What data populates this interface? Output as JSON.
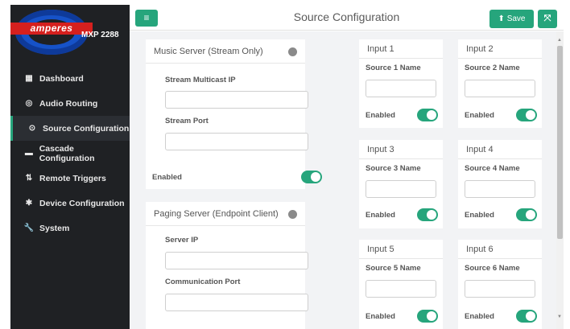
{
  "sidebar": {
    "logo_text": "amperes",
    "model": "MXP 2288",
    "items": [
      {
        "label": "Dashboard",
        "icon": "dashboard-icon",
        "glyph": "▦"
      },
      {
        "label": "Audio Routing",
        "icon": "audio-routing-icon",
        "glyph": "◎"
      },
      {
        "label": "Source Configuration",
        "icon": "source-config-icon",
        "glyph": "⊙"
      },
      {
        "label": "Cascade Configuration",
        "icon": "cascade-icon",
        "glyph": "▬"
      },
      {
        "label": "Remote Triggers",
        "icon": "remote-triggers-icon",
        "glyph": "⇅"
      },
      {
        "label": "Device Configuration",
        "icon": "gear-icon",
        "glyph": "✱"
      },
      {
        "label": "System",
        "icon": "wrench-icon",
        "glyph": "🔧"
      }
    ],
    "active_index": 2
  },
  "header": {
    "menu_glyph": "≡",
    "title": "Source Configuration",
    "save_label": "Save",
    "save_glyph": "⬆",
    "expand_glyph": "⤧"
  },
  "music_server": {
    "title": "Music Server (Stream Only)",
    "field1_label": "Stream Multicast IP",
    "field1_value": "",
    "field2_label": "Stream Port",
    "field2_value": "",
    "enabled_label": "Enabled"
  },
  "paging_server": {
    "title": "Paging Server (Endpoint Client)",
    "field1_label": "Server IP",
    "field1_value": "",
    "field2_label": "Communication Port",
    "field2_value": ""
  },
  "inputs": [
    {
      "title": "Input 1",
      "name_label": "Source 1 Name",
      "enabled_label": "Enabled"
    },
    {
      "title": "Input 2",
      "name_label": "Source 2 Name",
      "enabled_label": "Enabled"
    },
    {
      "title": "Input 3",
      "name_label": "Source 3 Name",
      "enabled_label": "Enabled"
    },
    {
      "title": "Input 4",
      "name_label": "Source 4 Name",
      "enabled_label": "Enabled"
    },
    {
      "title": "Input 5",
      "name_label": "Source 5 Name",
      "enabled_label": "Enabled"
    },
    {
      "title": "Input 6",
      "name_label": "Source 6 Name",
      "enabled_label": "Enabled"
    }
  ],
  "colors": {
    "accent": "#26a57c",
    "sidebar": "#1f2124",
    "status_dot": "#8a8a8a"
  }
}
